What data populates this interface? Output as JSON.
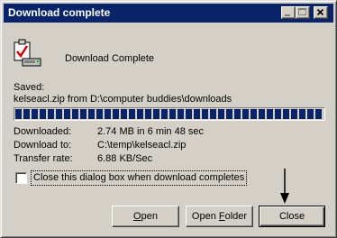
{
  "window": {
    "title": "Download complete"
  },
  "header": {
    "message": "Download Complete"
  },
  "saved": {
    "label": "Saved:",
    "path": "kelseacl.zip from D:\\computer buddies\\downloads"
  },
  "progress": {
    "percent": 100
  },
  "details": {
    "downloaded_label": "Downloaded:",
    "downloaded_value": "2.74 MB in  6 min 48 sec",
    "download_to_label": "Download to:",
    "download_to_value": "C:\\temp\\kelseacl.zip",
    "transfer_rate_label": "Transfer rate:",
    "transfer_rate_value": "6.88 KB/Sec"
  },
  "checkbox": {
    "label": "Close this dialog box when download completes",
    "checked": false
  },
  "buttons": {
    "open_first": "O",
    "open_rest": "pen",
    "open_folder_pre": "Open ",
    "open_folder_acc": "F",
    "open_folder_post": "older",
    "close": "Close"
  },
  "colors": {
    "title_bar": "#0a246a",
    "progress_fill": "#0a246a",
    "face": "#d4d0c8"
  },
  "icons": {
    "app": "download-complete-icon",
    "minimize": "minimize-icon",
    "maximize": "maximize-icon",
    "close": "close-icon",
    "annotation": "arrow-down-icon"
  }
}
